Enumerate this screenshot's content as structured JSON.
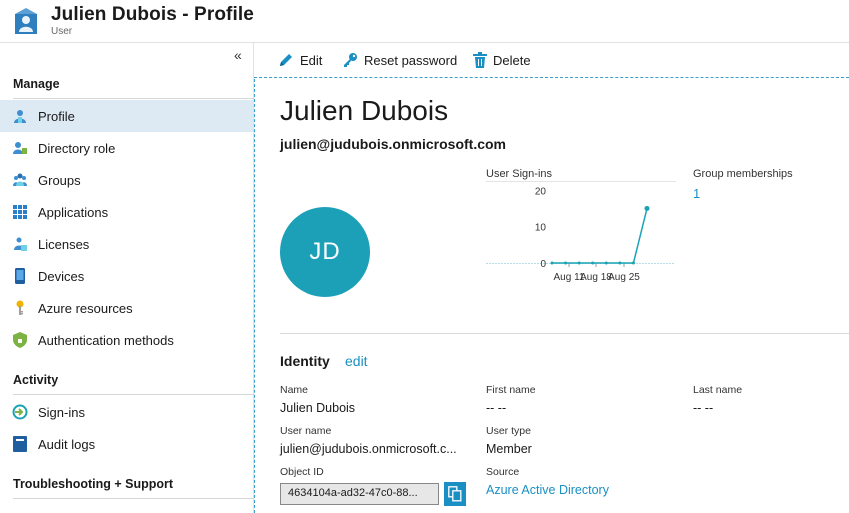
{
  "header": {
    "title": "Julien Dubois - Profile",
    "subtitle": "User",
    "icon": "user-profile-icon"
  },
  "sidebar": {
    "collapse_icon": "«",
    "sections": [
      {
        "title": "Manage"
      },
      {
        "title": "Activity"
      },
      {
        "title": "Troubleshooting + Support"
      }
    ],
    "items": [
      {
        "label": "Profile",
        "icon": "user-icon",
        "active": true
      },
      {
        "label": "Directory role",
        "icon": "directory-role-icon"
      },
      {
        "label": "Groups",
        "icon": "groups-icon"
      },
      {
        "label": "Applications",
        "icon": "applications-grid-icon"
      },
      {
        "label": "Licenses",
        "icon": "licenses-icon"
      },
      {
        "label": "Devices",
        "icon": "devices-icon"
      },
      {
        "label": "Azure resources",
        "icon": "key-icon"
      },
      {
        "label": "Authentication methods",
        "icon": "shield-icon"
      },
      {
        "label": "Sign-ins",
        "icon": "sign-ins-icon"
      },
      {
        "label": "Audit logs",
        "icon": "audit-logs-icon"
      }
    ]
  },
  "toolbar": {
    "edit_label": "Edit",
    "reset_label": "Reset password",
    "delete_label": "Delete"
  },
  "profile": {
    "name": "Julien Dubois",
    "email": "julien@judubois.onmicrosoft.com",
    "initials": "JD"
  },
  "signins": {
    "label": "User Sign-ins"
  },
  "chart_data": {
    "type": "line",
    "title": "User Sign-ins",
    "x_ticks": [
      "Aug 11",
      "Aug 18",
      "Aug 25"
    ],
    "y_ticks": [
      0,
      10,
      20
    ],
    "ylim": [
      0,
      22
    ],
    "x": [
      "Aug 11",
      "Aug 13",
      "Aug 16",
      "Aug 18",
      "Aug 20",
      "Aug 23",
      "Aug 25",
      "Aug 26"
    ],
    "values": [
      0,
      0,
      0,
      0,
      0,
      0,
      0,
      15
    ]
  },
  "groups": {
    "label": "Group memberships",
    "value": "1"
  },
  "identity": {
    "title": "Identity",
    "edit": "edit",
    "name_label": "Name",
    "name_value": "Julien Dubois",
    "first_name_label": "First name",
    "first_name_value": "-- --",
    "last_name_label": "Last name",
    "last_name_value": "-- --",
    "username_label": "User name",
    "username_value": "julien@judubois.onmicrosoft.c...",
    "usertype_label": "User type",
    "usertype_value": "Member",
    "objectid_label": "Object ID",
    "objectid_value": "4634104a-ad32-47c0-88...",
    "source_label": "Source",
    "source_value": "Azure Active Directory"
  },
  "colors": {
    "accent": "#1a8fc4",
    "avatar": "#1ca0b8",
    "active_bg": "#dde9f3",
    "chart_line": "#1aa3b5"
  }
}
